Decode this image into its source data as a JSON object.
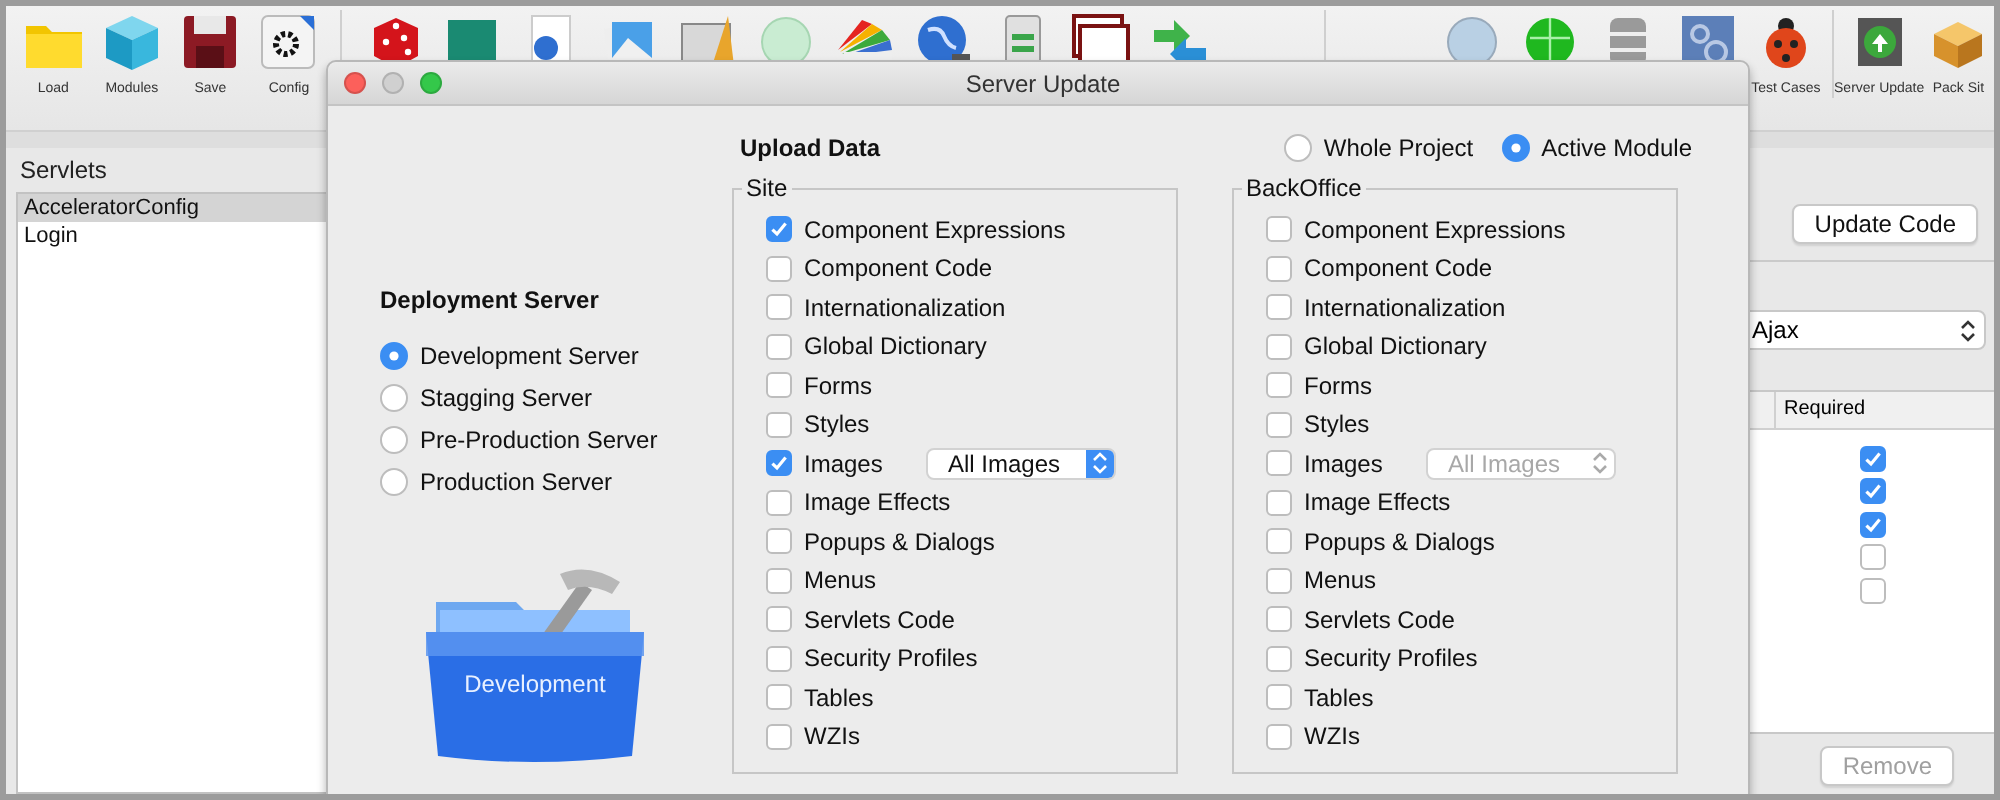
{
  "toolbar": {
    "items": [
      {
        "kind": "labeled",
        "label": "Load"
      },
      {
        "kind": "labeled",
        "label": "Modules"
      },
      {
        "kind": "labeled",
        "label": "Save"
      },
      {
        "kind": "labeled",
        "label": "Config"
      },
      {
        "kind": "separator"
      },
      {
        "kind": "icon"
      },
      {
        "kind": "icon"
      },
      {
        "kind": "icon"
      },
      {
        "kind": "icon"
      },
      {
        "kind": "icon"
      },
      {
        "kind": "icon"
      },
      {
        "kind": "icon"
      },
      {
        "kind": "icon"
      },
      {
        "kind": "icon"
      },
      {
        "kind": "icon"
      },
      {
        "kind": "icon"
      },
      {
        "kind": "separator"
      },
      {
        "kind": "icon"
      },
      {
        "kind": "icon"
      },
      {
        "kind": "icon"
      },
      {
        "kind": "icon"
      },
      {
        "kind": "labeled",
        "label": "Test Cases"
      },
      {
        "kind": "separator"
      },
      {
        "kind": "labeled",
        "label": "Server Update"
      },
      {
        "kind": "labeled",
        "label": "Pack Sit"
      }
    ]
  },
  "servlets": {
    "title": "Servlets",
    "items": [
      {
        "label": "AcceleratorConfig",
        "selected": true
      },
      {
        "label": "Login",
        "selected": false
      }
    ]
  },
  "right_panel": {
    "update_button": "Update Code",
    "library_select": "Ajax",
    "table": {
      "columns": [
        "Required"
      ],
      "rows": [
        {
          "required": true
        },
        {
          "required": true
        },
        {
          "required": true
        },
        {
          "required": false
        },
        {
          "required": false
        }
      ]
    },
    "remove_button": {
      "label": "Remove",
      "disabled": true
    }
  },
  "dialog": {
    "title": "Server Update",
    "deployment": {
      "title": "Deployment Server",
      "options": [
        {
          "label": "Development Server",
          "selected": true
        },
        {
          "label": "Stagging Server",
          "selected": false
        },
        {
          "label": "Pre-Production Server",
          "selected": false
        },
        {
          "label": "Production Server",
          "selected": false
        }
      ],
      "image_label": "Development"
    },
    "upload": {
      "title": "Upload Data",
      "scope": [
        {
          "label": "Whole Project",
          "selected": false
        },
        {
          "label": "Active Module",
          "selected": true
        }
      ],
      "groups": [
        {
          "title": "Site",
          "items": [
            {
              "label": "Component Expressions",
              "checked": true
            },
            {
              "label": "Component Code",
              "checked": false
            },
            {
              "label": "Internationalization",
              "checked": false
            },
            {
              "label": "Global Dictionary",
              "checked": false
            },
            {
              "label": "Forms",
              "checked": false
            },
            {
              "label": "Styles",
              "checked": false
            },
            {
              "label": "Images",
              "checked": true,
              "select": {
                "value": "All Images",
                "disabled": false
              }
            },
            {
              "label": "Image Effects",
              "checked": false
            },
            {
              "label": "Popups & Dialogs",
              "checked": false
            },
            {
              "label": "Menus",
              "checked": false
            },
            {
              "label": "Servlets Code",
              "checked": false
            },
            {
              "label": "Security Profiles",
              "checked": false
            },
            {
              "label": "Tables",
              "checked": false
            },
            {
              "label": "WZIs",
              "checked": false
            }
          ]
        },
        {
          "title": "BackOffice",
          "items": [
            {
              "label": "Component Expressions",
              "checked": false
            },
            {
              "label": "Component Code",
              "checked": false
            },
            {
              "label": "Internationalization",
              "checked": false
            },
            {
              "label": "Global Dictionary",
              "checked": false
            },
            {
              "label": "Forms",
              "checked": false
            },
            {
              "label": "Styles",
              "checked": false
            },
            {
              "label": "Images",
              "checked": false,
              "select": {
                "value": "All Images",
                "disabled": true
              }
            },
            {
              "label": "Image Effects",
              "checked": false
            },
            {
              "label": "Popups & Dialogs",
              "checked": false
            },
            {
              "label": "Menus",
              "checked": false
            },
            {
              "label": "Servlets Code",
              "checked": false
            },
            {
              "label": "Security Profiles",
              "checked": false
            },
            {
              "label": "Tables",
              "checked": false
            },
            {
              "label": "WZIs",
              "checked": false
            }
          ]
        }
      ]
    }
  }
}
